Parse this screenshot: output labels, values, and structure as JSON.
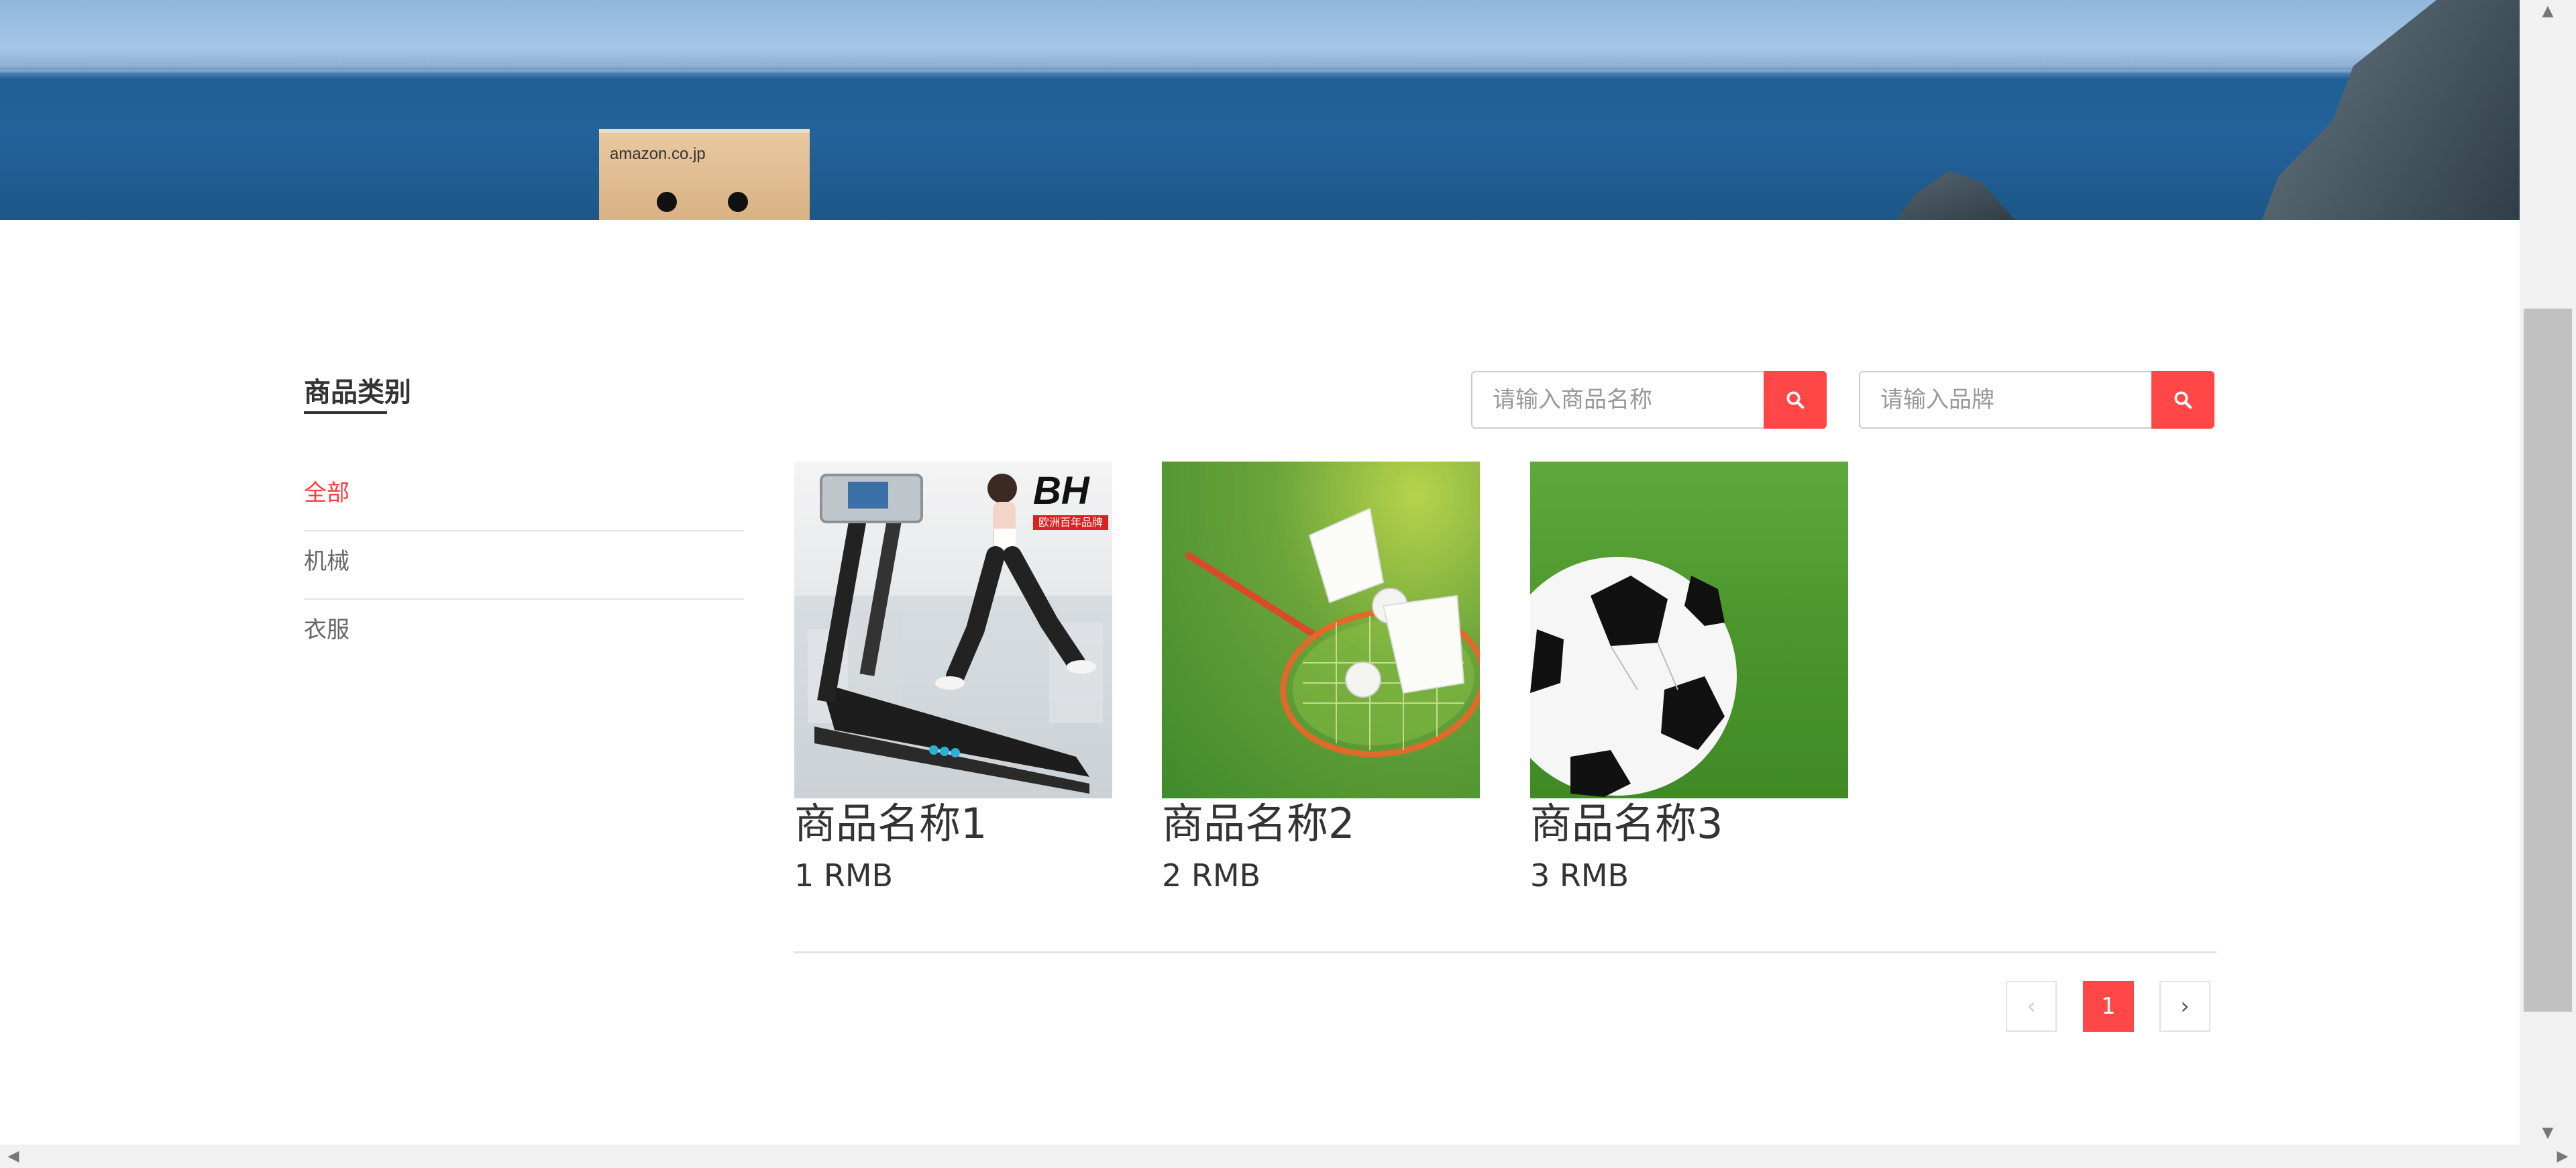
{
  "banner": {
    "box_logo_text": "amazon.co.jp"
  },
  "sidebar": {
    "title": "商品类别",
    "categories": [
      {
        "label": "全部",
        "active": true
      },
      {
        "label": "机械",
        "active": false
      },
      {
        "label": "衣服",
        "active": false
      }
    ]
  },
  "search": {
    "name_placeholder": "请输入商品名称",
    "brand_placeholder": "请输入品牌",
    "button_icon": "search-icon"
  },
  "products": [
    {
      "name": "商品名称1",
      "price": "1 RMB",
      "image": "treadmill",
      "image_badge": "BH",
      "image_sub": "欧洲百年品牌"
    },
    {
      "name": "商品名称2",
      "price": "2 RMB",
      "image": "badminton-racket-shuttlecocks"
    },
    {
      "name": "商品名称3",
      "price": "3 RMB",
      "image": "soccer-ball-on-grass"
    }
  ],
  "pagination": {
    "prev": "‹",
    "current": "1",
    "next": "›"
  },
  "colors": {
    "accent": "#ff4747",
    "active_category": "#ff3c3c"
  }
}
